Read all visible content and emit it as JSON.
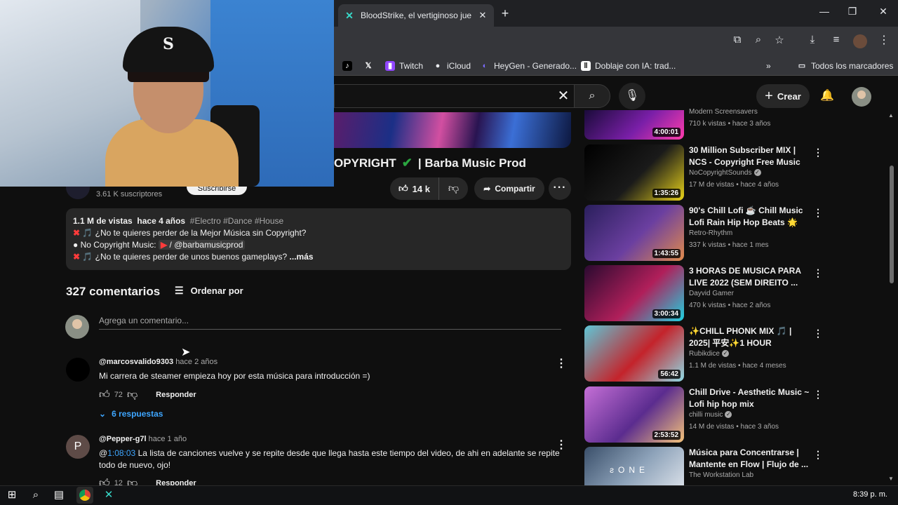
{
  "browser": {
    "tab_title": "BloodStrike, el vertiginoso jueg",
    "bookmarks": [
      {
        "label": "",
        "icon": "tiktok-icon"
      },
      {
        "label": "",
        "icon": "x-icon"
      },
      {
        "label": "Twitch",
        "icon": "twitch-icon"
      },
      {
        "label": "iCloud",
        "icon": "apple-icon"
      },
      {
        "label": "HeyGen - Generado...",
        "icon": "heygen-icon"
      },
      {
        "label": "Doblaje con IA: trad...",
        "icon": "doblaje-icon"
      }
    ],
    "all_bookmarks": "Todos los marcadores"
  },
  "masthead": {
    "create_label": "Crear"
  },
  "video": {
    "title": "OPYRIGHT",
    "title_suffix": "| Barba Music Prod",
    "subscribers": "3.61 K suscriptores",
    "subscribe_label": "Suscribirse",
    "likes": "14 k",
    "share_label": "Compartir",
    "description": {
      "views": "1.1 M de vistas",
      "age": "hace 4 años",
      "tags": "#Electro #Dance #House",
      "line1": "🎵 ¿No te quieres perder de la Mejor Música sin Copyright?",
      "line2_prefix": "● No Copyright Music:",
      "line2_link": "/ @barbamusicprod",
      "line3": "🎵 ¿No te quieres perder de unos buenos gameplays?",
      "more": "...más"
    }
  },
  "comments": {
    "count": "327 comentarios",
    "sort_label": "Ordenar por",
    "add_placeholder": "Agrega un comentario...",
    "items": [
      {
        "author": "@marcosvalido9303",
        "time": "hace 2 años",
        "text": "Mi carrera de steamer empieza hoy por esta música para introducción  =)",
        "likes": "72",
        "reply_label": "Responder",
        "replies": "6 respuestas"
      },
      {
        "author": "@Pepper-g7l",
        "time": "hace 1 año",
        "avatar_letter": "P",
        "timestamp": "1:08:03",
        "text": " La lista de canciones vuelve y se repite desde que llega hasta este tiempo del video, de ahi en adelante se repite todo de nuevo, ojo!",
        "likes": "12",
        "reply_label": "Responder"
      }
    ]
  },
  "recommendations": [
    {
      "title": "",
      "channel": "Modern Screensavers",
      "stats": "710 k vistas • hace 3 años",
      "duration": "4:00:01",
      "colors": [
        "#1a0b3a",
        "#7a1fa8",
        "#ff3cac"
      ]
    },
    {
      "title": "30 Million Subscriber MIX | NCS - Copyright Free Music",
      "channel": "NoCopyrightSounds",
      "verified": true,
      "stats": "17 M de vistas • hace 4 años",
      "duration": "1:35:26",
      "colors": [
        "#000000",
        "#1a1a1a",
        "#e8d21a"
      ]
    },
    {
      "title": "90's Chill Lofi ☕ Chill Music Lofi Rain Hip Hop Beats 🌟 Lo...",
      "channel": "Retro-Rhythm",
      "stats": "337 k vistas • hace 1 mes",
      "duration": "1:43:55",
      "colors": [
        "#2a1f5c",
        "#6b3fa0",
        "#e08a4c"
      ]
    },
    {
      "title": "3 HORAS DE MUSICA PARA LIVE 2022 (SEM DIREITO ...",
      "channel": "Dayvid Gamer",
      "stats": "470 k vistas • hace 2 años",
      "duration": "3:00:34",
      "colors": [
        "#2a0a30",
        "#b01f5a",
        "#1fd1e0"
      ]
    },
    {
      "title": "✨CHILL PHONK MIX 🎵 | 2025| 平安✨1 HOUR",
      "channel": "Rubikdice",
      "verified": true,
      "stats": "1.1 M de vistas • hace 4 meses",
      "duration": "56:42",
      "colors": [
        "#5fc6d6",
        "#c4232b",
        "#8fdbe6"
      ]
    },
    {
      "title": "Chill Drive - Aesthetic Music ~ Lofi hip hop mix",
      "channel": "chilli music",
      "verified": true,
      "stats": "14 M de vistas • hace 3 años",
      "duration": "2:53:52",
      "colors": [
        "#c56fd6",
        "#5b2c8f",
        "#f4c27a"
      ]
    },
    {
      "title": "Música para Concentrarse | Mantente en Flow | Flujo de ...",
      "channel": "The Workstation Lab",
      "stats": "",
      "duration": "",
      "overlay": "ƨONE",
      "colors": [
        "#3a4f6a",
        "#8ea3ba",
        "#d6dde6"
      ]
    }
  ],
  "taskbar": {
    "clock": "8:39 p. m."
  },
  "webcam": {
    "cap_logo": "S"
  }
}
